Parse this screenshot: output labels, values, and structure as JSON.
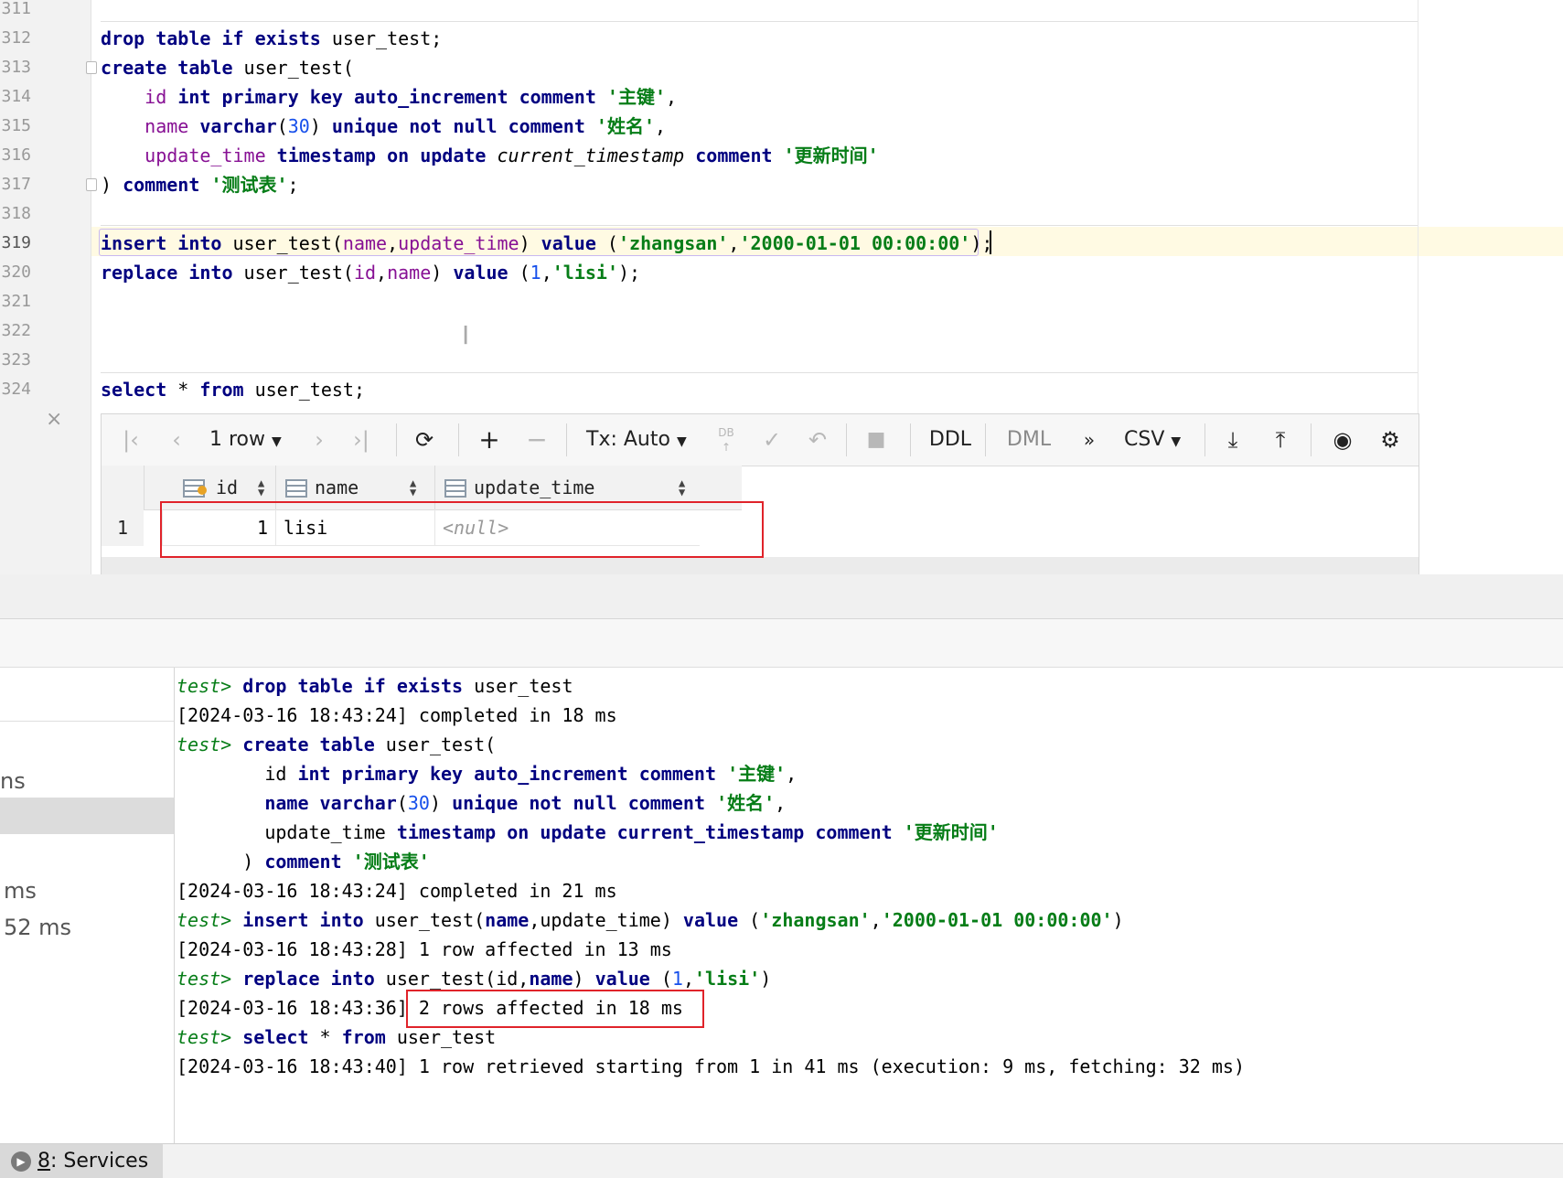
{
  "editor": {
    "line_numbers": [
      "311",
      "312",
      "313",
      "314",
      "315",
      "316",
      "317",
      "318",
      "319",
      "320",
      "321",
      "322",
      "323",
      "324"
    ],
    "strings": {
      "pk_comment": "'主键'",
      "name_comment": "'姓名'",
      "time_comment": "'更新时间'",
      "table_comment": "'测试表'",
      "zhangsan": "'zhangsan'",
      "date": "'2000-01-01 00:00:00'",
      "lisi": "'lisi'"
    }
  },
  "results": {
    "toolbar": {
      "rows_label": "1 row",
      "tx_label": "Tx: Auto",
      "db_label": "DB",
      "ddl_label": "DDL",
      "dml_label": "DML",
      "more_label": "»",
      "csv_label": "CSV"
    },
    "columns": [
      "id",
      "name",
      "update_time"
    ],
    "rows": [
      {
        "num": "1",
        "id": "1",
        "name": "lisi",
        "update_time": "<null>"
      }
    ]
  },
  "services": {
    "left_items": [
      "ns",
      "ms",
      "52 ms"
    ],
    "tab_label": "8: Services",
    "tab_mnemonic": "8",
    "tab_text": ": Services"
  },
  "console": {
    "prompt": "test>",
    "log": [
      "[2024-03-16 18:43:24] completed in 18 ms",
      "[2024-03-16 18:43:24] completed in 21 ms",
      "[2024-03-16 18:43:28] 1 row affected in 13 ms",
      "[2024-03-16 18:43:36]",
      "2 rows affected in 18 ms",
      "[2024-03-16 18:43:40] 1 row retrieved starting from 1 in 41 ms (execution: 9 ms, fetching: 32 ms)"
    ]
  },
  "colors": {
    "keyword": "#000080",
    "string": "#067d17",
    "number": "#1750eb",
    "highlight_box": "#e0232a",
    "active_line": "#fffae3"
  }
}
